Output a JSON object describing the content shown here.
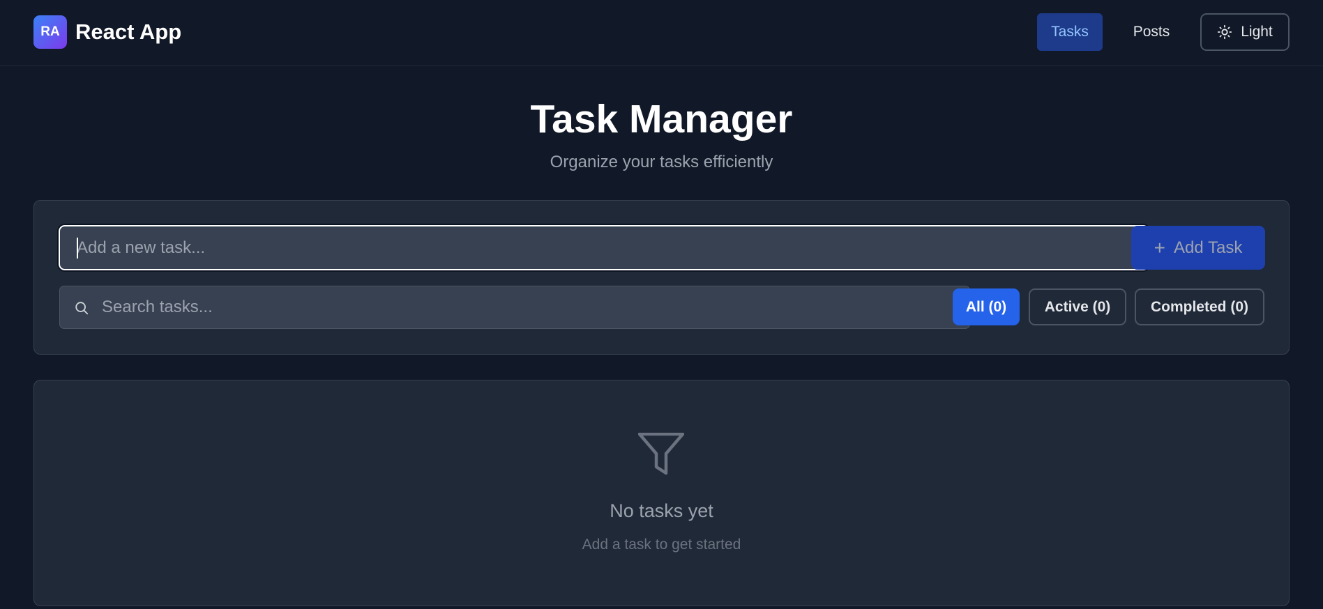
{
  "header": {
    "logo_text": "RA",
    "brand": "React App",
    "nav": {
      "tasks": "Tasks",
      "posts": "Posts",
      "theme": "Light"
    }
  },
  "page": {
    "title": "Task Manager",
    "subtitle": "Organize your tasks efficiently"
  },
  "task_input": {
    "placeholder": "Add a new task...",
    "value": "",
    "add_label": "Add Task"
  },
  "search": {
    "placeholder": "Search tasks..."
  },
  "filters": {
    "all": "All (0)",
    "active": "Active (0)",
    "completed": "Completed (0)",
    "selected": "all"
  },
  "empty_state": {
    "icon": "filter-icon",
    "title": "No tasks yet",
    "subtitle": "Add a task to get started"
  },
  "colors": {
    "background": "#111827",
    "card": "#1f2937",
    "accent": "#2563eb",
    "nav_active": "#1e3a8a"
  }
}
